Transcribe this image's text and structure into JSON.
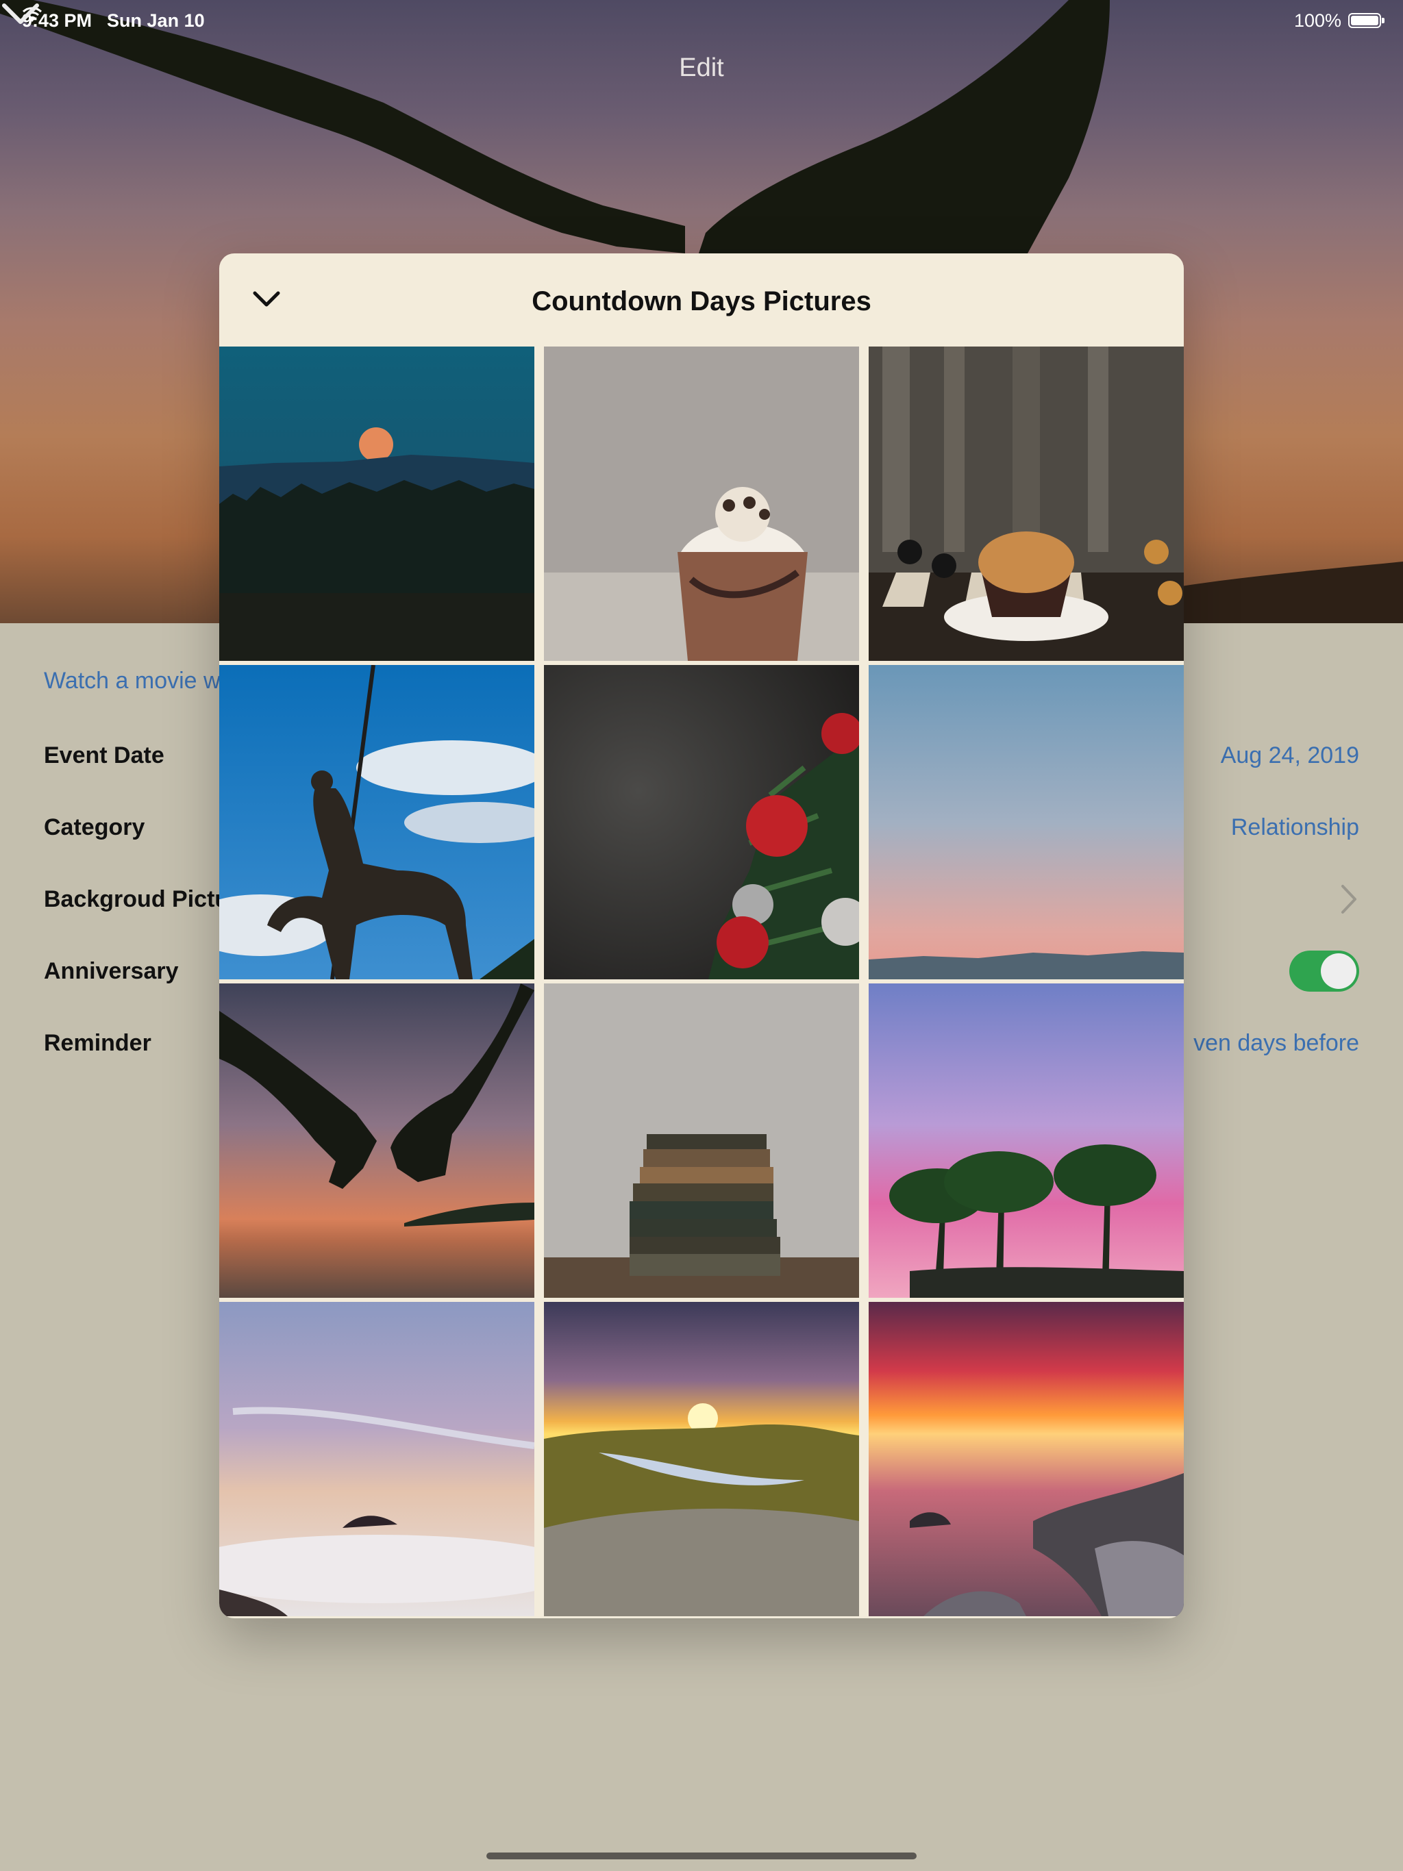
{
  "status_bar": {
    "time": "9:43 PM",
    "date": "Sun Jan 10",
    "battery": "100%"
  },
  "nav": {
    "title": "Edit",
    "back_icon": "chevron-down-icon"
  },
  "form": {
    "note": "Watch a movie w",
    "rows": [
      {
        "label": "Event Date",
        "value": "Aug 24, 2019"
      },
      {
        "label": "Category",
        "value": "Relationship"
      },
      {
        "label": "Backgroud Pictu",
        "value": ""
      },
      {
        "label": "Anniversary",
        "value": ""
      },
      {
        "label": "Reminder",
        "value": "ven days before"
      }
    ],
    "anniversary_on": true
  },
  "modal": {
    "title": "Countdown Days Pictures",
    "close_icon": "chevron-down-icon",
    "pictures": [
      {
        "name": "moon-over-forest"
      },
      {
        "name": "chocolate-milkshake"
      },
      {
        "name": "muffin-chessboard"
      },
      {
        "name": "centaur-statue"
      },
      {
        "name": "christmas-ornaments"
      },
      {
        "name": "pastel-sky-horizon"
      },
      {
        "name": "holding-hands-sunset"
      },
      {
        "name": "stack-of-books"
      },
      {
        "name": "palm-trees-pink-sky"
      },
      {
        "name": "misty-sea-sunrise"
      },
      {
        "name": "sunburst-lake-valley"
      },
      {
        "name": "red-sunset-rocks"
      }
    ]
  },
  "colors": {
    "accent": "#3b6fb0",
    "toggle_on": "#2fa44f",
    "modal_bg": "#f3ecdb",
    "page_bg": "#c4bfae"
  }
}
